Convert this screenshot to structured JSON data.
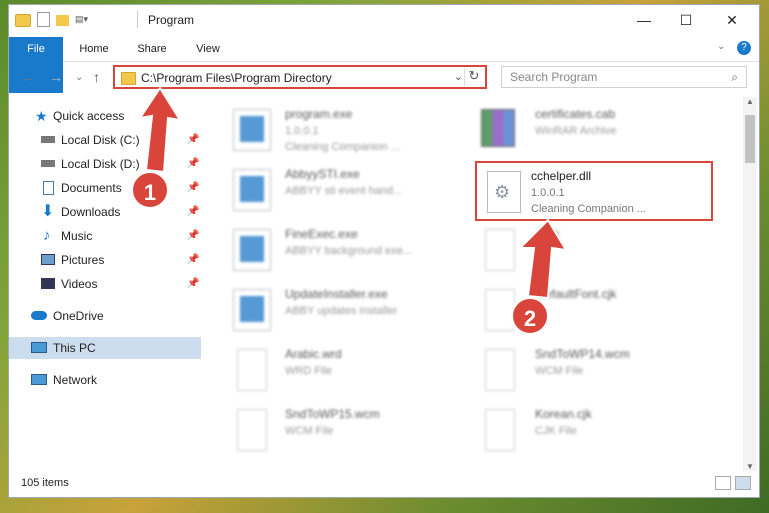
{
  "window": {
    "title": "Program"
  },
  "ribbon": {
    "tabs": [
      "File",
      "Home",
      "Share",
      "View"
    ]
  },
  "address": {
    "path": "C:\\Program Files\\Program Directory"
  },
  "search": {
    "placeholder": "Search Program"
  },
  "sidebar": {
    "items": [
      {
        "label": "Quick access",
        "icon": "star-icon",
        "pinned": false
      },
      {
        "label": "Local Disk (C:)",
        "icon": "drive-icon",
        "pinned": true
      },
      {
        "label": "Local Disk (D:)",
        "icon": "drive-icon",
        "pinned": true
      },
      {
        "label": "Documents",
        "icon": "documents-icon",
        "pinned": true
      },
      {
        "label": "Downloads",
        "icon": "download-icon",
        "pinned": true
      },
      {
        "label": "Music",
        "icon": "music-icon",
        "pinned": true
      },
      {
        "label": "Pictures",
        "icon": "pictures-icon",
        "pinned": true
      },
      {
        "label": "Videos",
        "icon": "videos-icon",
        "pinned": true
      },
      {
        "label": "OneDrive",
        "icon": "cloud-icon",
        "pinned": false
      },
      {
        "label": "This PC",
        "icon": "computer-icon",
        "pinned": false,
        "selected": true
      },
      {
        "label": "Network",
        "icon": "network-icon",
        "pinned": false
      }
    ]
  },
  "files": [
    {
      "name": "program.exe",
      "line2": "1.0.0.1",
      "line3": "Cleaning Companion ...",
      "type": "app"
    },
    {
      "name": "certificates.cab",
      "line2": "WinRAR Archive",
      "line3": "",
      "type": "rar"
    },
    {
      "name": "AbbyySTI.exe",
      "line2": "ABBYY sti event hand...",
      "line3": "",
      "type": "app"
    },
    {
      "name": "cchelper.dll",
      "line2": "1.0.0.1",
      "line3": "Cleaning Companion ...",
      "type": "dll",
      "highlighted": true
    },
    {
      "name": "FineExec.exe",
      "line2": "ABBYY background exe...",
      "line3": "",
      "type": "app"
    },
    {
      "name": "...cjk",
      "line2": "",
      "line3": "",
      "type": "doc"
    },
    {
      "name": "UpdateInstaller.exe",
      "line2": "ABBY updates installer",
      "line3": "",
      "type": "app"
    },
    {
      "name": "...efaultFont.cjk",
      "line2": "",
      "line3": "",
      "type": "doc"
    },
    {
      "name": "Arabic.wrd",
      "line2": "WRD File",
      "line3": "",
      "type": "doc"
    },
    {
      "name": "SndToWP14.wcm",
      "line2": "WCM File",
      "line3": "",
      "type": "doc"
    },
    {
      "name": "SndToWP15.wcm",
      "line2": "WCM File",
      "line3": "",
      "type": "doc"
    },
    {
      "name": "Korean.cjk",
      "line2": "CJK File",
      "line3": "",
      "type": "doc"
    }
  ],
  "annotations": {
    "badge1": "1",
    "badge2": "2",
    "color": "#d9453a"
  },
  "status": {
    "count": "105 items"
  }
}
